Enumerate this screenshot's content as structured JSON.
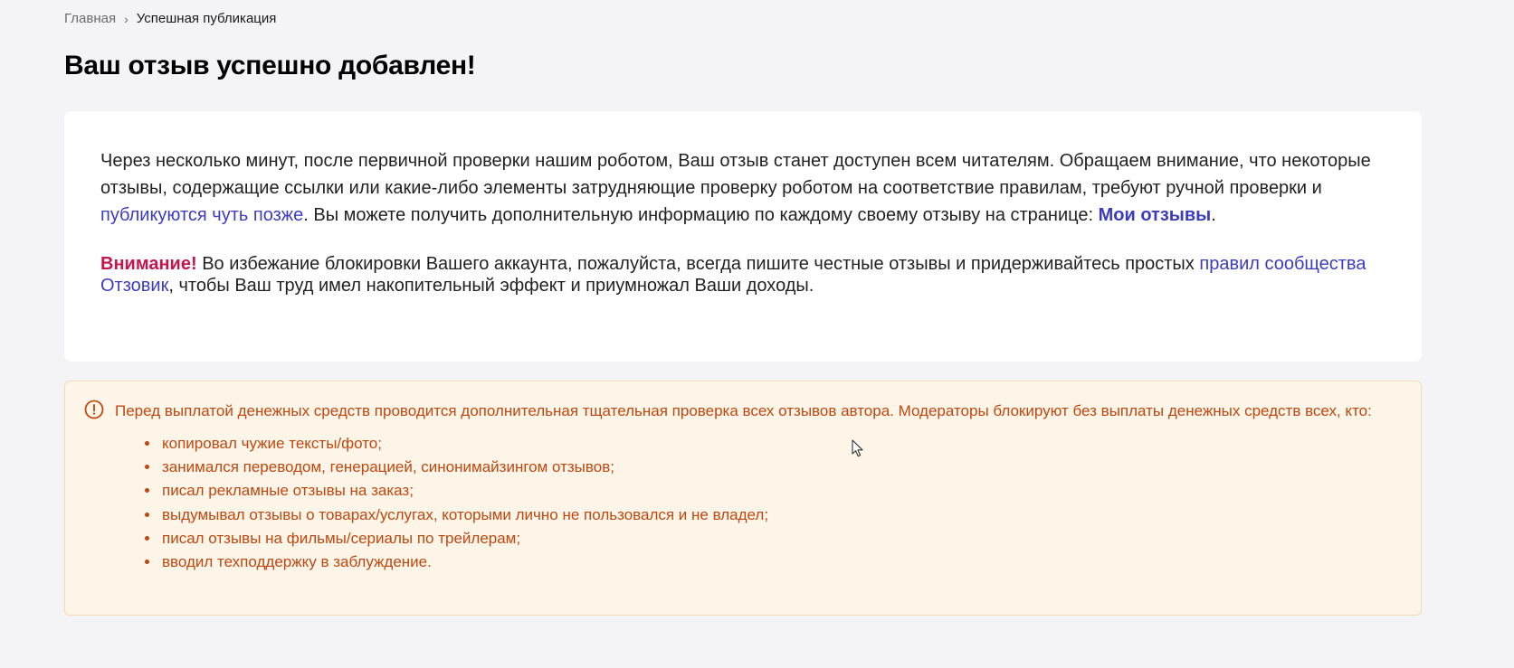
{
  "breadcrumb": {
    "home": "Главная",
    "separator": "›",
    "current": "Успешная публикация"
  },
  "page": {
    "title": "Ваш отзыв успешно добавлен!"
  },
  "info": {
    "p1_text1": "Через несколько минут, после первичной проверки нашим роботом, Ваш отзыв станет доступен всем читателям. Обращаем внимание, что некоторые отзывы, содержащие ссылки или какие-либо элементы затрудняющие проверку роботом на соответствие правилам, требуют ручной проверки и ",
    "p1_link1": "публикуются чуть позже",
    "p1_text2": ". Вы можете получить дополнительную информацию по каждому своему отзыву на странице: ",
    "p1_link2": "Мои отзывы",
    "p1_text3": ".",
    "attention_label": "Внимание!",
    "p2_text1": " Во избежание блокировки Вашего аккаунта, пожалуйста, всегда пишите честные отзывы и придерживайтесь простых ",
    "p2_link": "правил сообщества Отзовик",
    "p2_text2": ", чтобы Ваш труд имел накопительный эффект и приумножал Ваши доходы."
  },
  "warning": {
    "icon": "exclamation-circle-icon",
    "text": "Перед выплатой денежных средств проводится дополнительная тщательная проверка всех отзывов автора. Модераторы блокируют без выплаты денежных средств всех, кто:",
    "items": [
      "копировал чужие тексты/фото;",
      "занимался переводом, генерацией, синонимайзингом отзывов;",
      "писал рекламные отзывы на заказ;",
      "выдумывал отзывы о товарах/услугах, которыми лично не пользовался и не владел;",
      "писал отзывы на фильмы/сериалы по трейлерам;",
      "вводил техподдержку в заблуждение."
    ]
  },
  "colors": {
    "link": "#3c3cc0",
    "attention": "#c4154f",
    "warning_text": "#c0470f",
    "warning_bg": "#fdf5e8"
  }
}
